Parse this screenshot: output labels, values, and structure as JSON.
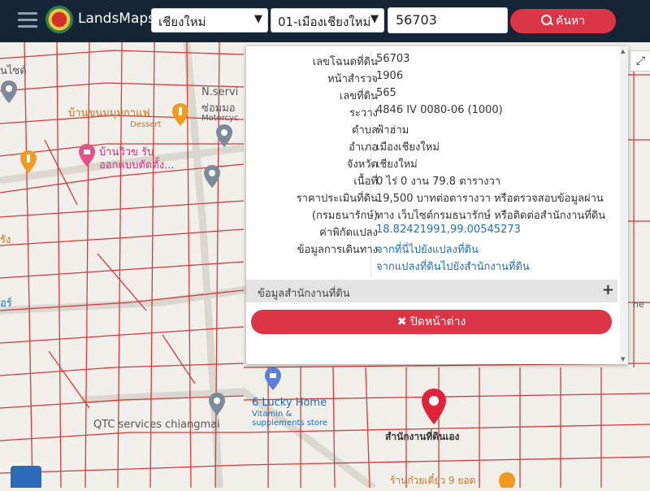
{
  "header": {
    "brand": "LandsMaps",
    "province": "เชียงใหม่",
    "district": "01-เมืองเชียงใหม่",
    "parcel_input": "56703",
    "search_label": "ค้นหา"
  },
  "popup": {
    "rows": [
      {
        "label": "เลขโฉนดที่ดิน",
        "value": "56703"
      },
      {
        "label": "หน้าสำรวจ",
        "value": "1906"
      },
      {
        "label": "เลขที่ดิน",
        "value": "565"
      },
      {
        "label": "ระวาง",
        "value": "4846 IV 0080-06 (1000)"
      },
      {
        "label": "ตำบล",
        "value": "ฟ้าฮ่าม"
      },
      {
        "label": "อำเภอ",
        "value": "เมืองเชียงใหม่"
      },
      {
        "label": "จังหวัด",
        "value": "เชียงใหม่"
      },
      {
        "label": "เนื้อที่",
        "value": "0 ไร่ 0 งาน 79.8 ตารางวา"
      },
      {
        "label": "ราคาประเมินที่ดิน",
        "value": "19,500 บาทต่อตารางวา หรือตรวจสอบข้อมูลผ่าน"
      },
      {
        "label": "(กรมธนารักษ์)",
        "value": "ทาง เว็บไซต์กรมธนารักษ์ หรือติดต่อสำนักงานที่ดิน"
      },
      {
        "label": "ค่าพิกัดแปลง",
        "value": "18.82421991,99.00545273"
      },
      {
        "label": "ข้อมูลการเดินทาง",
        "value": "จากที่นี่ไปยังแปลงที่ดิน"
      },
      {
        "label": "",
        "value": "จากแปลงที่ดินไปยังสำนักงานที่ดิน"
      }
    ],
    "office_section": "ข้อมูลสำนักงานที่ดิน",
    "close_label": "ปิดหน้าต่าง"
  },
  "map": {
    "labels": {
      "l1": "นไซด์",
      "l2": "N.servi",
      "l3": "ซ่อมมอ",
      "l4": "Motorcyc",
      "l5": "บ้านขนมมุมกาแฟ",
      "l6": "Dessert",
      "l7": "บ้านวิวข รับ",
      "l8": "ออกแบบตัดตั้ง...",
      "l9": "6 Lucky Home",
      "l10": "Vitamin &",
      "l11": "supplements store",
      "l12": "QTC services chiangmai",
      "l13": "สำนักงานที่ดินเอง",
      "l14": "ร้านก๋วยเตี๋ยว 9 ยอด",
      "l15": "รัง",
      "l16": "อร์",
      "l17": "ne"
    }
  }
}
